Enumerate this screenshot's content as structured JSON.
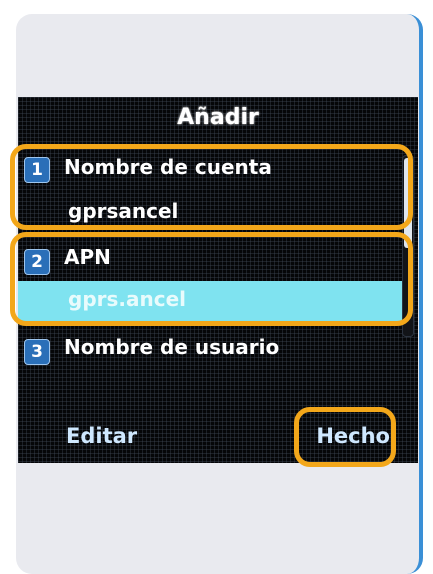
{
  "screen": {
    "title": "Añadir",
    "items": [
      {
        "number": "1",
        "label": "Nombre de cuenta",
        "value": "gprsancel"
      },
      {
        "number": "2",
        "label": "APN",
        "value": "gprs.ancel",
        "selected": true
      },
      {
        "number": "3",
        "label": "Nombre de usuario"
      }
    ],
    "softkeys": {
      "left": "Editar",
      "right": "Hecho"
    }
  },
  "colors": {
    "highlight": "#f3a71a",
    "selected_row": "#7fe3f0",
    "card_background": "#e9eaef",
    "accent_border": "#3a8fd6"
  }
}
